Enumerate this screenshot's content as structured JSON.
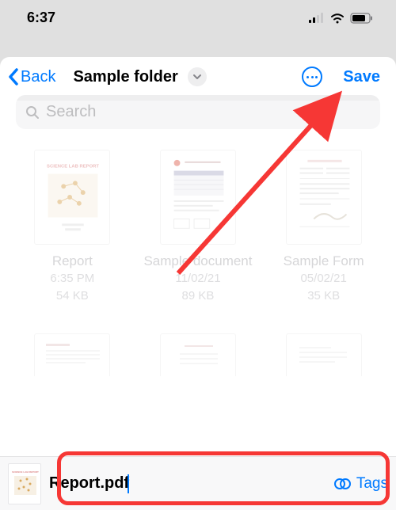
{
  "status": {
    "time": "6:37"
  },
  "nav": {
    "back_label": "Back",
    "title": "Sample folder",
    "save_label": "Save"
  },
  "search": {
    "placeholder": "Search"
  },
  "files": [
    {
      "name": "Report",
      "line1": "6:35 PM",
      "line2": "54 KB"
    },
    {
      "name": "Sample document",
      "line1": "11/02/21",
      "line2": "89 KB"
    },
    {
      "name": "Sample Form",
      "line1": "05/02/21",
      "line2": "35 KB"
    }
  ],
  "bottom": {
    "filename": "Report.pdf",
    "tags_label": "Tags"
  }
}
